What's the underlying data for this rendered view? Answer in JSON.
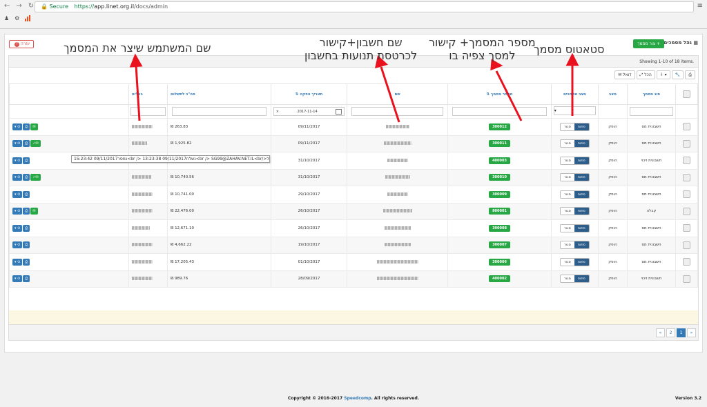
{
  "browser": {
    "secure_label": "Secure",
    "url_scheme": "https://",
    "url_host": "app.linet.org.il",
    "url_path": "/docs/admin"
  },
  "page": {
    "help_label": "עזרה",
    "add_doc_label": "צור מסמך +",
    "title": "נהל מסמכים",
    "summary": "Showing 1-10 of 18 items.",
    "tools": [
      "הכל",
      "דואל"
    ]
  },
  "columns": {
    "doc_type": "סוג מסמך",
    "state": "מצב",
    "status_buttons": "מצב מסמכים",
    "doc_number": "מספר מסמך",
    "name": "שם",
    "date": "תאריך הפקה",
    "total": "סה\"כ לתשלום",
    "owner": "בעלים"
  },
  "filter": {
    "status_select": "",
    "date_value": "2017-11-14"
  },
  "rows": [
    {
      "type": "חשבונית מס",
      "state": "הופק",
      "open": "פתוח",
      "closed": "סגור",
      "num": "300012",
      "date": "09/11/2017",
      "total": "263.83 ₪"
    },
    {
      "type": "חשבונית מס",
      "state": "הופק",
      "open": "פתוח",
      "closed": "סגור",
      "num": "300011",
      "date": "09/11/2017",
      "total": "1,925.82 ₪"
    },
    {
      "type": "חשבונית זיכוי",
      "state": "הופק",
      "open": "פתוח",
      "closed": "סגור",
      "num": "400003",
      "date": "31/10/2017",
      "total": "₪"
    },
    {
      "type": "חשבונית מס",
      "state": "הופק",
      "open": "פתוח",
      "closed": "סגור",
      "num": "300010",
      "date": "31/10/2017",
      "total": "10,740.56 ₪"
    },
    {
      "type": "חשבונית מס",
      "state": "הופק",
      "open": "פתוח",
      "closed": "סגור",
      "num": "300009",
      "date": "29/10/2017",
      "total": "10,741.00 ₪"
    },
    {
      "type": "קבלה",
      "state": "הופק",
      "open": "פתוח",
      "closed": "סגור",
      "num": "800001",
      "date": "26/10/2017",
      "total": "22,476.00 ₪"
    },
    {
      "type": "חשבונית מס",
      "state": "הופק",
      "open": "פתוח",
      "closed": "סגור",
      "num": "300008",
      "date": "26/10/2017",
      "total": "12,671.10 ₪"
    },
    {
      "type": "חשבונית מס",
      "state": "הופק",
      "open": "פתוח",
      "closed": "סגור",
      "num": "300007",
      "date": "19/10/2017",
      "total": "4,662.22 ₪"
    },
    {
      "type": "חשבונית מס",
      "state": "הופק",
      "open": "פתוח",
      "closed": "סגור",
      "num": "300006",
      "date": "01/10/2017",
      "total": "17,205.43 ₪"
    },
    {
      "type": "חשבונית זיכוי",
      "state": "הופק",
      "open": "פתוח",
      "closed": "סגור",
      "num": "400002",
      "date": "28/09/2017",
      "total": "989.76 ₪"
    }
  ],
  "tooltip": "15:23:42 09/11/2017נמסר<br /> 13:23:38 09/11/2017נשלח<br /> SG99@ZAHAV.NET.IL<br/>אל",
  "pager": [
    "«",
    "2",
    "1",
    "»"
  ],
  "footer": {
    "copyright_pre": "Copyright © 2016-2017",
    "brand": "Speedcomp",
    "copyright_post": ". All rights reserved.",
    "version": "Version 3.2"
  },
  "annotations": {
    "status": "סטאטוס מסמך",
    "doc_number_link": "מספר המסמך+ קישור\nלמסך צפיה בו",
    "account_link": "שם חשבון+קישור\nלכרטסת תנועות בחשבון",
    "creator": "שם המשתמש שיצר את המסמך"
  }
}
